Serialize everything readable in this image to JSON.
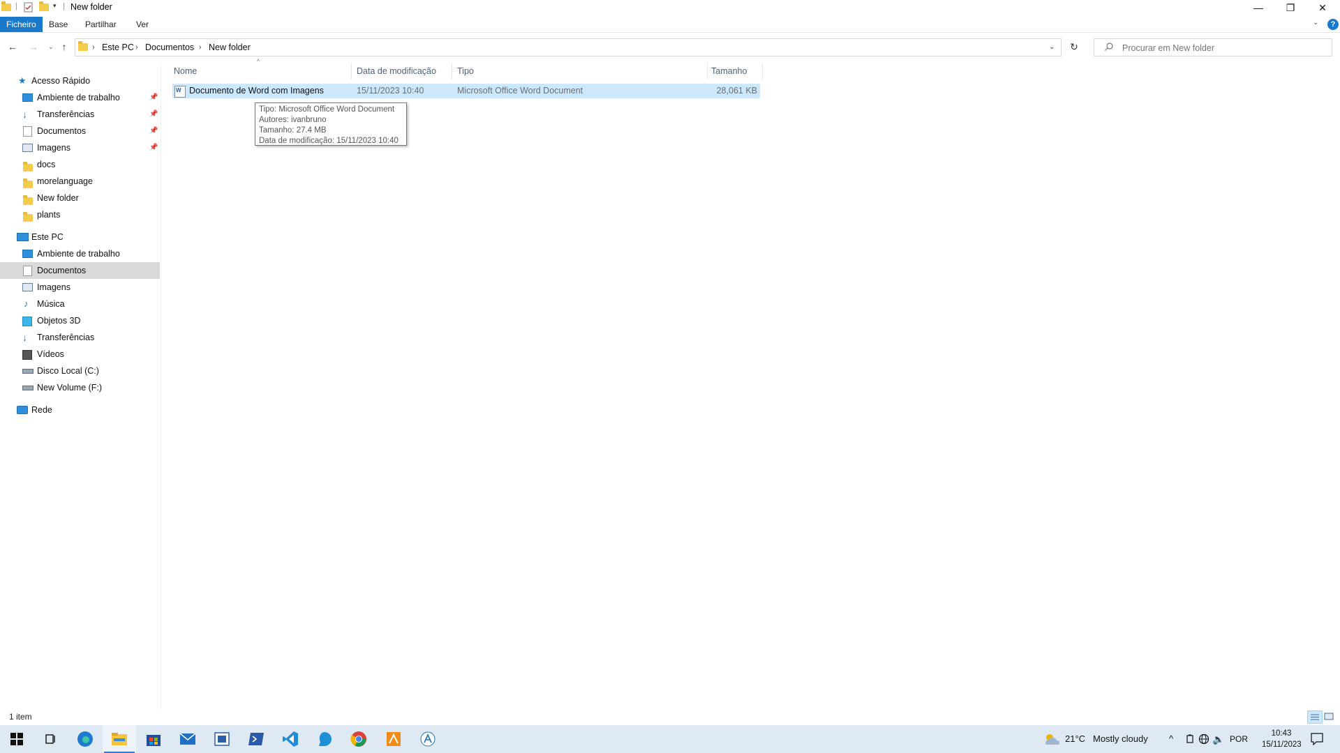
{
  "window": {
    "title": "New folder",
    "controls": {
      "minimize": "—",
      "maximize": "❐",
      "close": "✕"
    }
  },
  "ribbon": {
    "tabs": [
      {
        "label": "Ficheiro",
        "active": true
      },
      {
        "label": "Base",
        "active": false
      },
      {
        "label": "Partilhar",
        "active": false
      },
      {
        "label": "Ver",
        "active": false
      }
    ],
    "help": "?"
  },
  "address": {
    "crumbs": [
      "Este PC",
      "Documentos",
      "New folder"
    ],
    "separator": "›",
    "search_placeholder": "Procurar em New folder"
  },
  "sidebar": {
    "quick_access": {
      "label": "Acesso Rápido",
      "items": [
        {
          "label": "Ambiente de trabalho",
          "icon": "desktop-icon",
          "pinned": true
        },
        {
          "label": "Transferências",
          "icon": "download-icon",
          "pinned": true
        },
        {
          "label": "Documentos",
          "icon": "documents-icon",
          "pinned": true
        },
        {
          "label": "Imagens",
          "icon": "pictures-icon",
          "pinned": true
        },
        {
          "label": "docs",
          "icon": "folder-icon",
          "pinned": false
        },
        {
          "label": "morelanguage",
          "icon": "folder-icon",
          "pinned": false
        },
        {
          "label": "New folder",
          "icon": "folder-icon",
          "pinned": false
        },
        {
          "label": "plants",
          "icon": "folder-icon",
          "pinned": false
        }
      ]
    },
    "this_pc": {
      "label": "Este PC",
      "items": [
        {
          "label": "Ambiente de trabalho",
          "icon": "desktop-icon"
        },
        {
          "label": "Documentos",
          "icon": "documents-icon",
          "selected": true
        },
        {
          "label": "Imagens",
          "icon": "pictures-icon"
        },
        {
          "label": "Música",
          "icon": "music-icon"
        },
        {
          "label": "Objetos 3D",
          "icon": "3d-objects-icon"
        },
        {
          "label": "Transferências",
          "icon": "download-icon"
        },
        {
          "label": "Vídeos",
          "icon": "videos-icon"
        },
        {
          "label": "Disco Local (C:)",
          "icon": "drive-icon"
        },
        {
          "label": "New Volume (F:)",
          "icon": "drive-icon"
        }
      ]
    },
    "network": {
      "label": "Rede",
      "icon": "network-icon"
    }
  },
  "columns": {
    "name": "Nome",
    "modified": "Data de modificação",
    "type": "Tipo",
    "size": "Tamanho"
  },
  "files": [
    {
      "name": "Documento de Word com Imagens",
      "modified": "15/11/2023 10:40",
      "type": "Microsoft Office Word Document",
      "size": "28,061 KB"
    }
  ],
  "tooltip": {
    "line1": "Tipo: Microsoft Office Word Document",
    "line2": "Autores: ivanbruno",
    "line3": "Tamanho: 27.4 MB",
    "line4": "Data de modificação: 15/11/2023 10:40"
  },
  "status": {
    "count": "1 item"
  },
  "taskbar": {
    "apps": [
      "start-icon",
      "task-view-icon",
      "edge-icon",
      "file-explorer-icon",
      "store-icon",
      "mail-icon",
      "app-icon",
      "powershell-icon",
      "vscode-icon",
      "app-blue-icon",
      "chrome-icon",
      "app-orange-icon",
      "app-a-icon"
    ],
    "weather_temp": "21°C",
    "weather_desc": "Mostly cloudy",
    "language": "POR",
    "time": "10:43",
    "date": "15/11/2023"
  },
  "colors": {
    "accent": "#1979ca",
    "selection": "#cce8ff",
    "sidebar_selected": "#d9d9d9",
    "taskbar": "#dfe9f4"
  }
}
